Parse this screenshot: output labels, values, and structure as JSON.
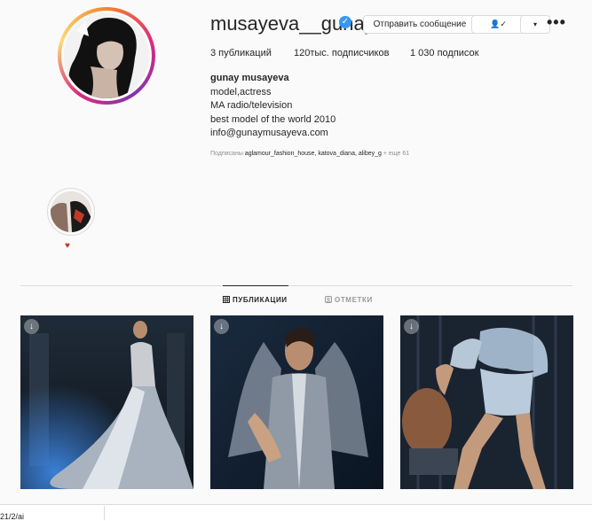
{
  "profile": {
    "username": "musayeva__gunay",
    "verified_mark": "✓",
    "message_button": "Отправить сообщение",
    "more_glyph": "•••",
    "dropdown_glyph": "▾",
    "follow_glyph": "👤✓"
  },
  "stats": {
    "posts": "3 публикаций",
    "followers": "120тыс. подписчиков",
    "following": "1 030 подписок"
  },
  "bio": {
    "name": "gunay musayeva",
    "lines": [
      "model,actress",
      "MA radio/television",
      "best model of the world 2010",
      "info@gunaymusayeva.com"
    ]
  },
  "followed_by": {
    "prefix": "Подписаны",
    "names": "aglamour_fashion_house, katova_diana, alibey_g",
    "more": "+ еще 61"
  },
  "highlight": {
    "label": "♥"
  },
  "tabs": {
    "posts": "ПУБЛИКАЦИИ",
    "tagged": "ОТМЕТКИ"
  },
  "icons": {
    "grid": "grid-icon",
    "tag": "tag-icon",
    "post_badge": "↓"
  },
  "colors": {
    "verified": "#3897f0",
    "highlight_heart": "#c0392b"
  },
  "footer": {
    "text": "21/2/ai"
  }
}
